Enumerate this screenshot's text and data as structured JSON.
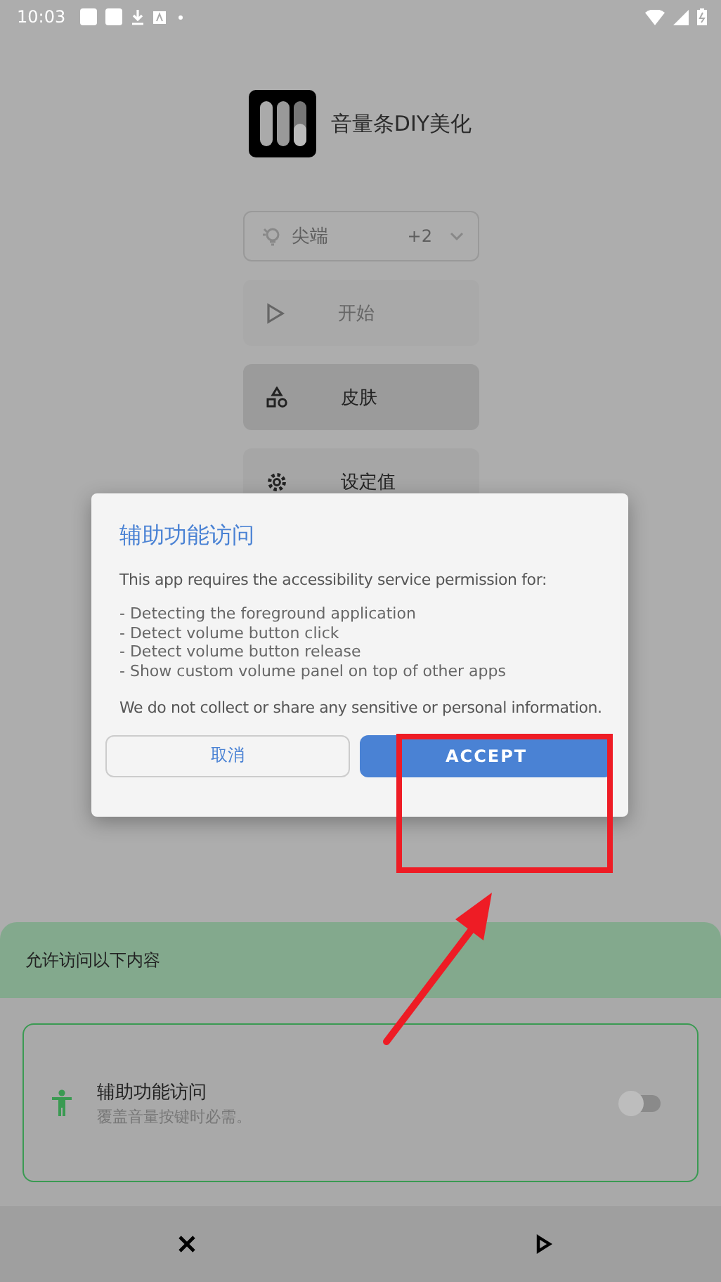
{
  "status_bar": {
    "time": "10:03"
  },
  "app": {
    "name": "音量条DIY美化"
  },
  "dropdown": {
    "value": "尖端",
    "count": "+2"
  },
  "menu": [
    {
      "kind": "play",
      "label": "开始",
      "disabled": true
    },
    {
      "kind": "shapes",
      "label": "皮肤",
      "disabled": false
    },
    {
      "kind": "gear",
      "label": "设定值",
      "disabled": false
    }
  ],
  "dialog": {
    "title": "辅助功能访问",
    "intro": "This app requires the accessibility service permission for:",
    "items": [
      "- Detecting the foreground application",
      "- Detect volume button click",
      "- Detect volume button release",
      "- Show custom volume panel on top of other apps"
    ],
    "note": "We do not collect or share any sensitive or personal information.",
    "buttons": [
      {
        "kind": "cancel",
        "label": "取消"
      },
      {
        "kind": "accept",
        "label": "ACCEPT"
      }
    ]
  },
  "sheet": {
    "header": "允许访问以下内容",
    "permission": {
      "title": "辅助功能访问",
      "subtitle": "覆盖音量按键时必需。",
      "on": false
    }
  }
}
